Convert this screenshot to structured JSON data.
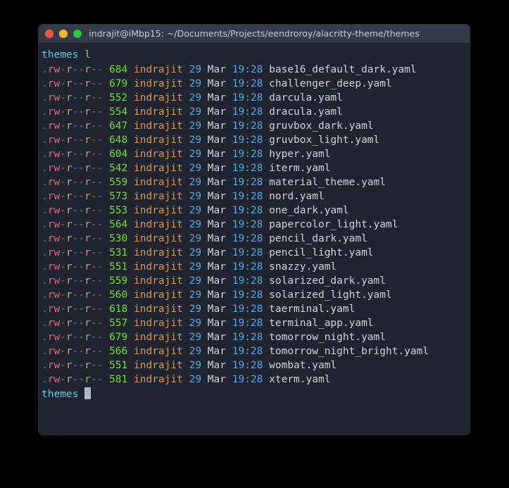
{
  "window": {
    "title": "indrajit@iMbp15: ~/Documents/Projects/eendroroy/alacritty-theme/themes",
    "controls": {
      "close_label": "close",
      "minimize_label": "minimize",
      "maximize_label": "maximize"
    },
    "colors": {
      "close": "#f9544b",
      "minimize": "#f9b52b",
      "maximize": "#2bc741",
      "titlebar_bg": "#353b49",
      "body_bg": "#1f2430",
      "page_bg": "#000000"
    }
  },
  "terminal": {
    "prompt_symbol": "themes",
    "command": "l",
    "cursor": "block",
    "columns": [
      "permissions",
      "size",
      "user",
      "day",
      "month",
      "time",
      "name"
    ],
    "shared": {
      "permissions": ".rw-r--r--",
      "user": "indrajit",
      "day": "29",
      "month": "Mar",
      "time": "19:28"
    },
    "rows": [
      {
        "permissions": ".rw-r--r--",
        "size": "684",
        "user": "indrajit",
        "day": "29",
        "month": "Mar",
        "time": "19:28",
        "name": "base16_default_dark.yaml"
      },
      {
        "permissions": ".rw-r--r--",
        "size": "679",
        "user": "indrajit",
        "day": "29",
        "month": "Mar",
        "time": "19:28",
        "name": "challenger_deep.yaml"
      },
      {
        "permissions": ".rw-r--r--",
        "size": "552",
        "user": "indrajit",
        "day": "29",
        "month": "Mar",
        "time": "19:28",
        "name": "darcula.yaml"
      },
      {
        "permissions": ".rw-r--r--",
        "size": "554",
        "user": "indrajit",
        "day": "29",
        "month": "Mar",
        "time": "19:28",
        "name": "dracula.yaml"
      },
      {
        "permissions": ".rw-r--r--",
        "size": "647",
        "user": "indrajit",
        "day": "29",
        "month": "Mar",
        "time": "19:28",
        "name": "gruvbox_dark.yaml"
      },
      {
        "permissions": ".rw-r--r--",
        "size": "648",
        "user": "indrajit",
        "day": "29",
        "month": "Mar",
        "time": "19:28",
        "name": "gruvbox_light.yaml"
      },
      {
        "permissions": ".rw-r--r--",
        "size": "604",
        "user": "indrajit",
        "day": "29",
        "month": "Mar",
        "time": "19:28",
        "name": "hyper.yaml"
      },
      {
        "permissions": ".rw-r--r--",
        "size": "542",
        "user": "indrajit",
        "day": "29",
        "month": "Mar",
        "time": "19:28",
        "name": "iterm.yaml"
      },
      {
        "permissions": ".rw-r--r--",
        "size": "559",
        "user": "indrajit",
        "day": "29",
        "month": "Mar",
        "time": "19:28",
        "name": "material_theme.yaml"
      },
      {
        "permissions": ".rw-r--r--",
        "size": "573",
        "user": "indrajit",
        "day": "29",
        "month": "Mar",
        "time": "19:28",
        "name": "nord.yaml"
      },
      {
        "permissions": ".rw-r--r--",
        "size": "553",
        "user": "indrajit",
        "day": "29",
        "month": "Mar",
        "time": "19:28",
        "name": "one_dark.yaml"
      },
      {
        "permissions": ".rw-r--r--",
        "size": "564",
        "user": "indrajit",
        "day": "29",
        "month": "Mar",
        "time": "19:28",
        "name": "papercolor_light.yaml"
      },
      {
        "permissions": ".rw-r--r--",
        "size": "530",
        "user": "indrajit",
        "day": "29",
        "month": "Mar",
        "time": "19:28",
        "name": "pencil_dark.yaml"
      },
      {
        "permissions": ".rw-r--r--",
        "size": "531",
        "user": "indrajit",
        "day": "29",
        "month": "Mar",
        "time": "19:28",
        "name": "pencil_light.yaml"
      },
      {
        "permissions": ".rw-r--r--",
        "size": "551",
        "user": "indrajit",
        "day": "29",
        "month": "Mar",
        "time": "19:28",
        "name": "snazzy.yaml"
      },
      {
        "permissions": ".rw-r--r--",
        "size": "559",
        "user": "indrajit",
        "day": "29",
        "month": "Mar",
        "time": "19:28",
        "name": "solarized_dark.yaml"
      },
      {
        "permissions": ".rw-r--r--",
        "size": "560",
        "user": "indrajit",
        "day": "29",
        "month": "Mar",
        "time": "19:28",
        "name": "solarized_light.yaml"
      },
      {
        "permissions": ".rw-r--r--",
        "size": "618",
        "user": "indrajit",
        "day": "29",
        "month": "Mar",
        "time": "19:28",
        "name": "taerminal.yaml"
      },
      {
        "permissions": ".rw-r--r--",
        "size": "557",
        "user": "indrajit",
        "day": "29",
        "month": "Mar",
        "time": "19:28",
        "name": "terminal_app.yaml"
      },
      {
        "permissions": ".rw-r--r--",
        "size": "679",
        "user": "indrajit",
        "day": "29",
        "month": "Mar",
        "time": "19:28",
        "name": "tomorrow_night.yaml"
      },
      {
        "permissions": ".rw-r--r--",
        "size": "566",
        "user": "indrajit",
        "day": "29",
        "month": "Mar",
        "time": "19:28",
        "name": "tomorrow_night_bright.yaml"
      },
      {
        "permissions": ".rw-r--r--",
        "size": "551",
        "user": "indrajit",
        "day": "29",
        "month": "Mar",
        "time": "19:28",
        "name": "wombat.yaml"
      },
      {
        "permissions": ".rw-r--r--",
        "size": "581",
        "user": "indrajit",
        "day": "29",
        "month": "Mar",
        "time": "19:28",
        "name": "xterm.yaml"
      }
    ]
  }
}
